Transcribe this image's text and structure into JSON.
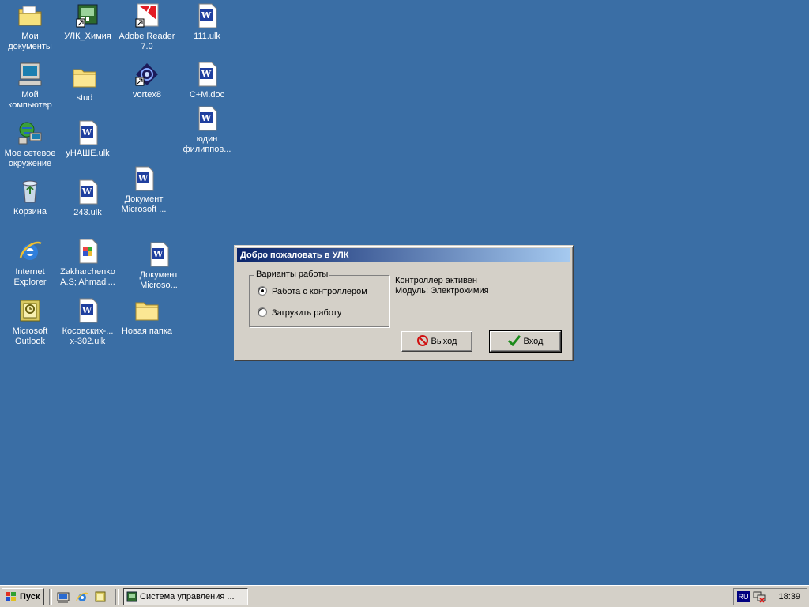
{
  "desktop": {
    "icons": [
      {
        "label": "Мои документы",
        "icon": "my-documents-icon"
      },
      {
        "label": "УЛК_Химия",
        "icon": "app-shortcut-icon"
      },
      {
        "label": "Adobe Reader 7.0",
        "icon": "adobe-reader-icon"
      },
      {
        "label": "111.ulk",
        "icon": "word-doc-icon"
      },
      {
        "label": "Мой компьютер",
        "icon": "my-computer-icon"
      },
      {
        "label": "stud",
        "icon": "folder-icon"
      },
      {
        "label": "vortex8",
        "icon": "vortex-shortcut-icon"
      },
      {
        "label": "C+M.doc",
        "icon": "word-doc-icon"
      },
      {
        "label": "юдин филиппов...",
        "icon": "word-doc-icon"
      },
      {
        "label": "Мое сетевое окружение",
        "icon": "network-icon"
      },
      {
        "label": "уНАШЕ.ulk",
        "icon": "word-doc-icon"
      },
      {
        "label": "Документ Microsoft ...",
        "icon": "word-doc-icon"
      },
      {
        "label": "Корзина",
        "icon": "recycle-bin-icon"
      },
      {
        "label": "243.ulk",
        "icon": "word-doc-icon"
      },
      {
        "label": "Internet Explorer",
        "icon": "ie-icon"
      },
      {
        "label": "Zakharchenko A.S; Ahmadi...",
        "icon": "doc-icon"
      },
      {
        "label": "Документ Microso...",
        "icon": "word-doc-icon"
      },
      {
        "label": "Microsoft Outlook",
        "icon": "outlook-icon"
      },
      {
        "label": "Косовских-... х-302.ulk",
        "icon": "word-doc-icon"
      },
      {
        "label": "Новая папка",
        "icon": "folder-icon"
      }
    ]
  },
  "dialog": {
    "title": "Добро пожаловать в УЛК",
    "group_label": "Варианты работы",
    "radio_options": [
      "Работа с контроллером",
      "Загрузить работу"
    ],
    "selected_index": 0,
    "status_line1": "Контроллер активен",
    "status_line2": "Модуль: Электрохимия",
    "exit_label": "Выход",
    "enter_label": "Вход"
  },
  "taskbar": {
    "start_label": "Пуск",
    "task_label": "Система управления ...",
    "lang": "RU",
    "clock": "18:39"
  },
  "colors": {
    "desktop": "#3a6ea5",
    "title_start": "#0a246a",
    "title_end": "#a6caf0",
    "face": "#d4d0c8"
  }
}
